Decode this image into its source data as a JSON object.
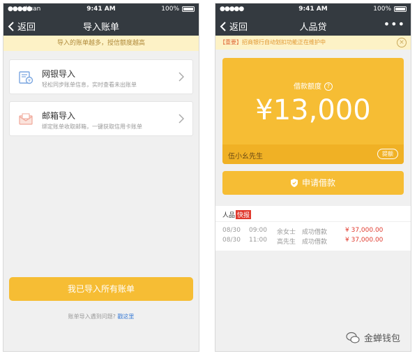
{
  "status": {
    "signal": "●●●●●",
    "carrier": "Yuan",
    "time": "9:41 AM",
    "battery": "100%"
  },
  "status2": {
    "signal": "●●●●●",
    "time": "9:41 AM",
    "battery": "100%"
  },
  "screen1": {
    "back_label": "返回",
    "title": "导入账单",
    "notice": "导入的账单越多，授信额度越高",
    "cards": [
      {
        "title": "网银导入",
        "subtitle": "轻松同步账单信息，实时查看未出账单"
      },
      {
        "title": "邮箱导入",
        "subtitle": "绑定账单收取邮箱，一键获取信用卡账单"
      }
    ],
    "import_button": "我已导入所有账单",
    "help_text": "账单导入遇到问题?",
    "help_link": "戳这里"
  },
  "screen2": {
    "back_label": "返回",
    "title": "人品贷",
    "more": "•••",
    "notice_tag": "【重要】",
    "notice_msg": "招商银行自动划扣功能正在维护中",
    "notice_close": "×",
    "amount_label": "借款额度",
    "amount_help": "?",
    "amount": "¥13,000",
    "user_name": "伍小幺先生",
    "raise_button": "提额",
    "apply_button": "申请借款",
    "news_title": "人品",
    "news_badge": "快报",
    "news_rows": [
      {
        "date": "08/30",
        "time": "09:00",
        "name": "余女士",
        "status": "成功借款",
        "amount": "¥ 37,000.00"
      },
      {
        "date": "08/30",
        "time": "11:00",
        "name": "高先生",
        "status": "成功借款",
        "amount": "¥ 37,000.00"
      }
    ]
  },
  "watermark": "金蝉钱包",
  "colors": {
    "accent": "#f6bd34",
    "navbar": "#343a40",
    "notice_bg": "#fdf2c6",
    "danger": "#e03a2e",
    "link": "#3a7bd5"
  }
}
